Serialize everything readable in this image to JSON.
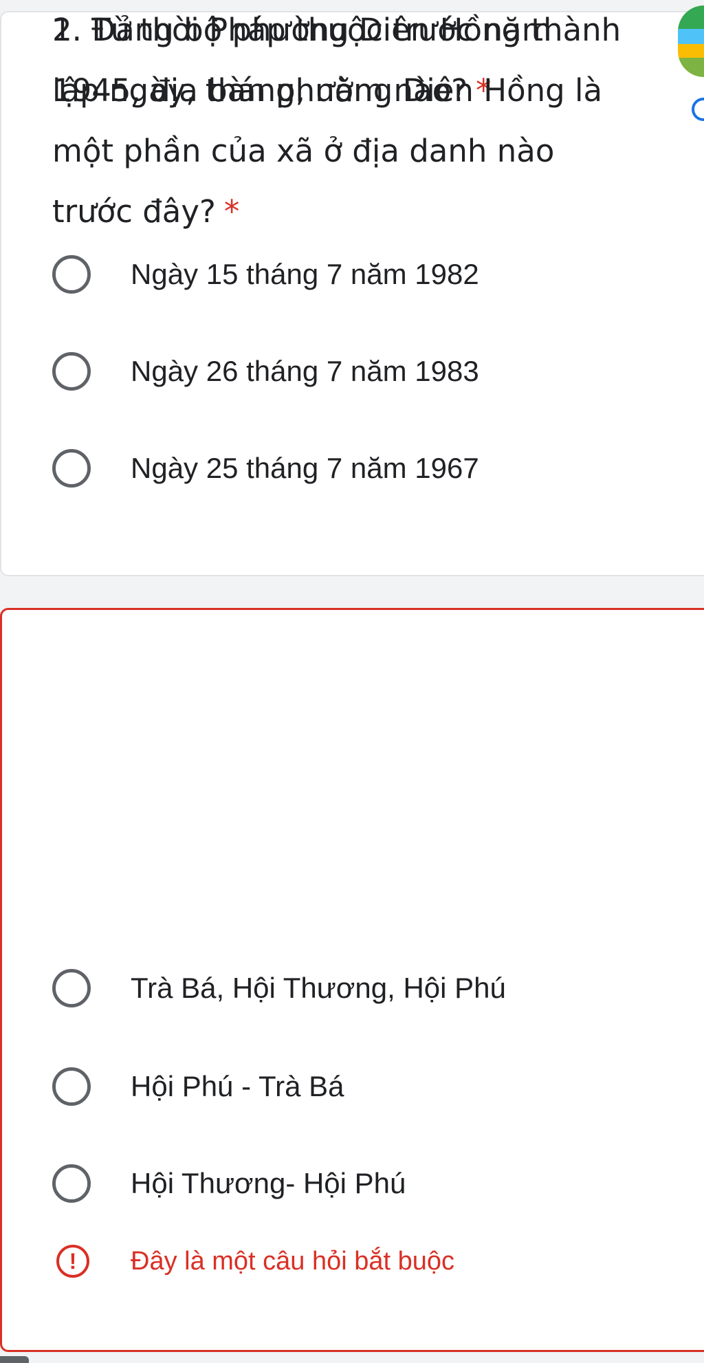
{
  "questions": [
    {
      "title_lines": [
        "1. Đảng bộ phường Diên Hồng thành",
        "lập ngày, tháng, năm nào?"
      ],
      "required_mark": "*",
      "options": [
        "Ngày 15 tháng 7 năm 1982",
        "Ngày 26 tháng 7 năm 1983",
        "Ngày 25 tháng 7 năm 1967"
      ]
    },
    {
      "title_lines": [
        "2. Từ thời Pháp thuộc trước năm",
        "1945, địa bàn phường Diên Hồng là",
        "một phần của xã ở địa danh nào",
        "trước đây?"
      ],
      "required_mark": "*",
      "options": [
        "Trà Bá, Hội Thương, Hội Phú",
        "Hội Phú - Trà Bá",
        "Hội Thương- Hội Phú"
      ],
      "error": {
        "icon": "!",
        "message": "Đây là một câu hỏi bắt buộc"
      }
    }
  ],
  "colors": {
    "error": "#d93025",
    "radio_border": "#5f6368",
    "text": "#202124",
    "card_background": "#ffffff",
    "page_background": "#f1f3f4"
  },
  "icons": {
    "radio": "radio-button-unchecked-icon",
    "error": "error-alert-icon",
    "logo": "corner-logo-icon",
    "chip": "info-chip-icon"
  }
}
